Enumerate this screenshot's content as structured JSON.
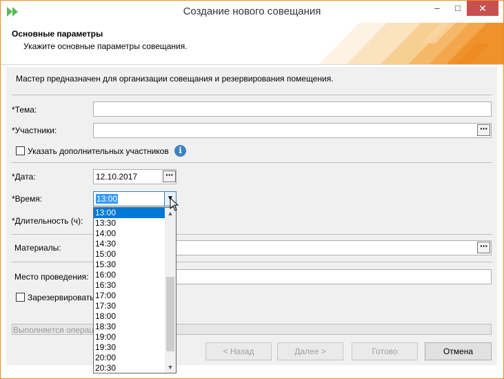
{
  "window": {
    "title": "Создание нового совещания",
    "minimize": "–",
    "maximize": "□",
    "close": "✕"
  },
  "header": {
    "title": "Основные параметры",
    "subtitle": "Укажите основные параметры совещания."
  },
  "description": "Мастер предназначен для организации совещания и резервирования помещения.",
  "form": {
    "topic_label": "*Тема:",
    "topic_value": "",
    "participants_label": "*Участники:",
    "participants_value": "",
    "dots": "···",
    "extra_participants_label": "Указать дополнительных участников",
    "extra_participants_checked": false,
    "info_icon": "i",
    "date_label": "*Дата:",
    "date_value": "12.10.2017",
    "time_label": "*Время:",
    "time_value": "13:00",
    "duration_label": "*Длительность (ч):",
    "materials_label": "Материалы:",
    "location_label": "Место проведения:",
    "reserve_label": "Зарезервировать",
    "reserve_checked": false
  },
  "time_options": [
    "13:00",
    "13:30",
    "14:00",
    "14:30",
    "15:00",
    "15:30",
    "16:00",
    "16:30",
    "17:00",
    "17:30",
    "18:00",
    "18:30",
    "19:00",
    "19:30",
    "20:00",
    "20:30"
  ],
  "time_selected_index": 0,
  "progress": {
    "text": "Выполняется операц"
  },
  "buttons": {
    "back": "< Назад",
    "next": "Далее >",
    "finish": "Готово",
    "cancel": "Отмена"
  },
  "colors": {
    "accent": "#f08a24",
    "selection": "#0078d7"
  }
}
